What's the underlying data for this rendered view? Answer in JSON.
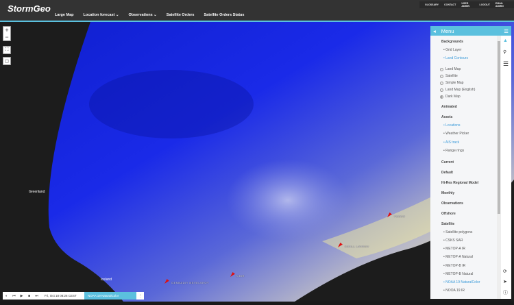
{
  "header": {
    "logo": "StormGeo",
    "nav": [
      "Large Map",
      "Location forecast ⌄",
      "Observations ⌄",
      "Satellite Orders",
      "Satellite Orders Status"
    ],
    "util": [
      "GLOSSARY",
      "CONTACT",
      "USER ADMIN",
      "LOGOUT",
      "EMAIL ADMIN"
    ]
  },
  "map": {
    "controls": {
      "zoom_in": "+",
      "zoom_out": "−"
    },
    "places": {
      "greenland": "Greenland",
      "iceland": "Iceland"
    },
    "vessels": [
      "GENNADIY NEVELSKOY",
      "SIBIR",
      "KIRILL LAVROV",
      "FESCO"
    ]
  },
  "menu": {
    "title": "Menu",
    "backgrounds": "Backgrounds",
    "bg_layers": [
      {
        "label": "• Grid Layer",
        "active": false
      },
      {
        "label": "• Land Contours",
        "active": true
      }
    ],
    "bg_maps": [
      {
        "label": "Land Map",
        "selected": false
      },
      {
        "label": "Satellite",
        "selected": false
      },
      {
        "label": "Simple Map",
        "selected": false
      },
      {
        "label": "Land Map (English)",
        "selected": false
      },
      {
        "label": "Dark Map",
        "selected": true
      }
    ],
    "animated": "Animated",
    "assets": "Assets",
    "asset_items": [
      {
        "label": "• Locations",
        "active": true
      },
      {
        "label": "• Weather Picker",
        "active": false
      },
      {
        "label": "• AIS track",
        "active": true
      },
      {
        "label": "• Range rings",
        "active": false
      }
    ],
    "groups": [
      "Current",
      "Default",
      "Hi-Res Regional Model",
      "Monthly",
      "Observations",
      "Offshore"
    ],
    "satellite": "Satellite",
    "sat_items": [
      {
        "label": "• Satellite polygons",
        "active": false
      },
      {
        "label": "• CSKS SAR",
        "active": false
      },
      {
        "label": "• METOP-A IR",
        "active": false
      },
      {
        "label": "• METOP-A Natural",
        "active": false
      },
      {
        "label": "• METOP-B IR",
        "active": false
      },
      {
        "label": "• METOP-B Natural",
        "active": false
      },
      {
        "label": "• NOAA 19 NaturalColor",
        "active": true
      },
      {
        "label": "• NOOA 19 IR",
        "active": false
      }
    ]
  },
  "timebar": {
    "time": "Fri, Oct 18 08:26 CEST",
    "layer": "NOAA 19 NaturalColor"
  },
  "colors": {
    "accent": "#5bc0de",
    "active_link": "#3a9ad9"
  }
}
